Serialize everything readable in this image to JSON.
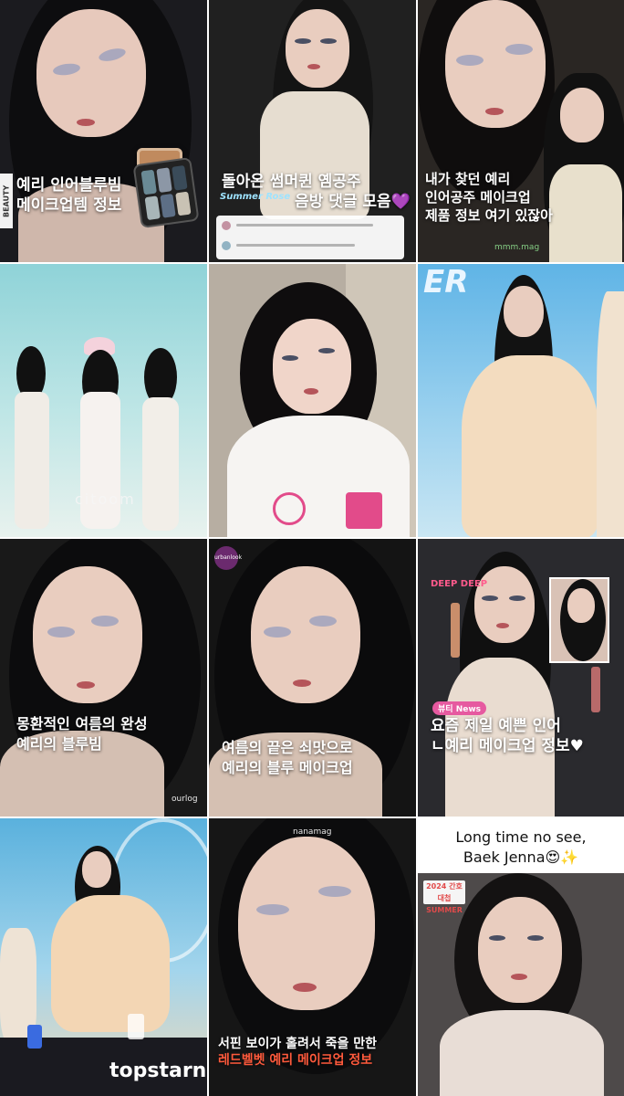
{
  "tiles": [
    {
      "caption": [
        "예리 인어블루빔",
        "메이크업템 정보"
      ],
      "side_badge": "BEAUTY"
    },
    {
      "caption": [
        "돌아온 썸머퀸 옘공주",
        "음방 댓글 모음"
      ],
      "emoji_heart": "💜",
      "sticker": "Summer Rose"
    },
    {
      "caption": [
        "내가 찾던 예리",
        "인어공주 메이크업",
        "제품 정보 여기 있잖아"
      ],
      "brand": "mmm.mag"
    },
    {
      "type": "stage-group",
      "watermark": "citoom"
    },
    {
      "type": "selfie"
    },
    {
      "type": "stage-solo"
    },
    {
      "caption": [
        "몽환적인 여름의 완성",
        "예리의 블루빔"
      ],
      "brand": "ourlog"
    },
    {
      "caption": [
        "여름의 끝은 쇠맛으로",
        "예리의 블루 메이크업"
      ],
      "logo": "urbanlook"
    },
    {
      "badge": "뷰티 News",
      "caption": [
        "요즘 제일 예쁜 인어",
        "ㄴ예리 메이크업 정보♥"
      ],
      "sticker": "DEEP DEEP"
    },
    {
      "type": "stage-fan",
      "watermark": "topstarne"
    },
    {
      "brand": "nanamag",
      "caption": [
        "서핀 보이가 홀려서 죽을 만한",
        "레드벨벳 예리 메이크업 정보"
      ]
    },
    {
      "headline": [
        "Long time no see,",
        "Baek Jenna😍✨"
      ],
      "logo": "2024 간호대첩 SUMMER"
    }
  ],
  "colors": {
    "accent_red": "#ff5a3c",
    "accent_pink": "#e65aa0",
    "purple_heart": "#9b4de0"
  }
}
